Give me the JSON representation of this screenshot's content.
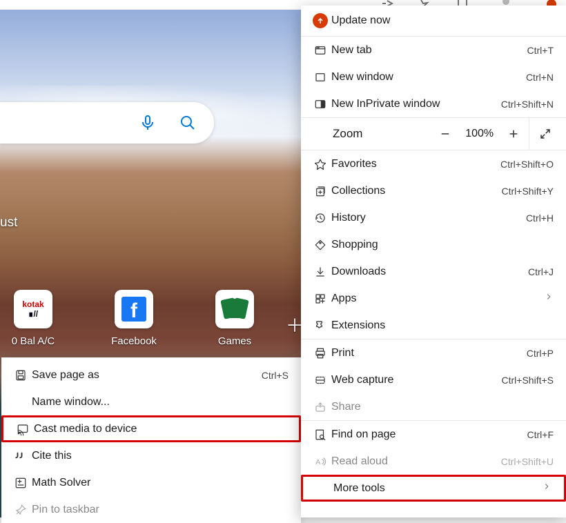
{
  "background_alt": "Desert coastline landscape with clouds and waves",
  "partial_label": "ust",
  "search": {
    "mic_icon": "microphone-icon",
    "search_icon": "search-icon"
  },
  "tiles": [
    {
      "label": "0 Bal A/C",
      "name": "tile-kotak"
    },
    {
      "label": "Facebook",
      "name": "tile-facebook"
    },
    {
      "label": "Games",
      "name": "tile-games"
    }
  ],
  "submenu": {
    "items": [
      {
        "label": "Save page as",
        "shortcut": "Ctrl+S",
        "icon": "save-icon",
        "interactable": true
      },
      {
        "label": "Name window...",
        "shortcut": "",
        "icon": "",
        "interactable": true
      },
      {
        "label": "Cast media to device",
        "shortcut": "",
        "icon": "cast-icon",
        "interactable": true,
        "highlight": true
      },
      {
        "label": "Cite this",
        "shortcut": "",
        "icon": "quote-icon",
        "interactable": true
      },
      {
        "label": "Math Solver",
        "shortcut": "",
        "icon": "math-icon",
        "interactable": true
      },
      {
        "label": "Pin to taskbar",
        "shortcut": "",
        "icon": "pin-icon",
        "interactable": true,
        "disabled": true
      }
    ]
  },
  "menu": {
    "update": {
      "label": "Update now",
      "icon": "update-icon"
    },
    "group1": [
      {
        "label": "New tab",
        "shortcut": "Ctrl+T",
        "icon": "tab-icon"
      },
      {
        "label": "New window",
        "shortcut": "Ctrl+N",
        "icon": "window-icon"
      },
      {
        "label": "New InPrivate window",
        "shortcut": "Ctrl+Shift+N",
        "icon": "inprivate-icon"
      }
    ],
    "zoom": {
      "label": "Zoom",
      "value": "100%"
    },
    "group2": [
      {
        "label": "Favorites",
        "shortcut": "Ctrl+Shift+O",
        "icon": "star-icon"
      },
      {
        "label": "Collections",
        "shortcut": "Ctrl+Shift+Y",
        "icon": "collections-icon"
      },
      {
        "label": "History",
        "shortcut": "Ctrl+H",
        "icon": "history-icon"
      },
      {
        "label": "Shopping",
        "shortcut": "",
        "icon": "tag-icon"
      },
      {
        "label": "Downloads",
        "shortcut": "Ctrl+J",
        "icon": "download-icon"
      },
      {
        "label": "Apps",
        "shortcut": "",
        "icon": "apps-icon",
        "chevron": true
      },
      {
        "label": "Extensions",
        "shortcut": "",
        "icon": "puzzle-icon"
      },
      {
        "label": "Print",
        "shortcut": "Ctrl+P",
        "icon": "print-icon"
      },
      {
        "label": "Web capture",
        "shortcut": "Ctrl+Shift+S",
        "icon": "capture-icon"
      },
      {
        "label": "Share",
        "shortcut": "",
        "icon": "share-icon",
        "disabled": true
      },
      {
        "label": "Find on page",
        "shortcut": "Ctrl+F",
        "icon": "find-icon"
      },
      {
        "label": "Read aloud",
        "shortcut": "Ctrl+Shift+U",
        "icon": "read-aloud-icon",
        "disabled": true
      },
      {
        "label": "More tools",
        "shortcut": "",
        "icon": "",
        "chevron": true,
        "highlight": true
      }
    ]
  }
}
